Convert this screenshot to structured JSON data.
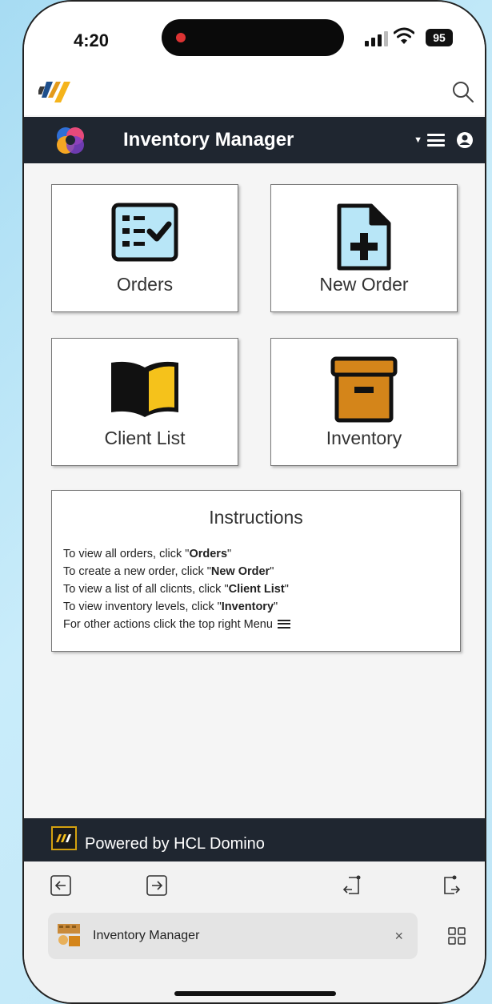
{
  "status_bar": {
    "time": "4:20",
    "battery": "95"
  },
  "header": {
    "title": "Inventory Manager"
  },
  "tiles": [
    {
      "label": "Orders"
    },
    {
      "label": "New Order"
    },
    {
      "label": "Client List"
    },
    {
      "label": "Inventory"
    }
  ],
  "instructions": {
    "title": "Instructions",
    "lines": [
      {
        "prefix": "To view all orders, click \"",
        "bold": "Orders",
        "suffix": "\""
      },
      {
        "prefix": "To create a new order, click \"",
        "bold": "New Order",
        "suffix": "\""
      },
      {
        "prefix": "To view a list of all clicnts, click \"",
        "bold": "Client List",
        "suffix": "\""
      },
      {
        "prefix": "To view inventory levels, click \"",
        "bold": "Inventory",
        "suffix": "\""
      },
      {
        "prefix": "For other actions click the top right Menu",
        "bold": "",
        "suffix": ""
      }
    ]
  },
  "footer": {
    "text": "Powered by HCL Domino"
  },
  "browser": {
    "tab_title": "Inventory Manager",
    "close_glyph": "×"
  },
  "colors": {
    "header_bg": "#1f2630",
    "tile_icon_blue": "#b8e6f7",
    "book_yellow": "#f5c21b",
    "box_orange": "#d4851a"
  }
}
